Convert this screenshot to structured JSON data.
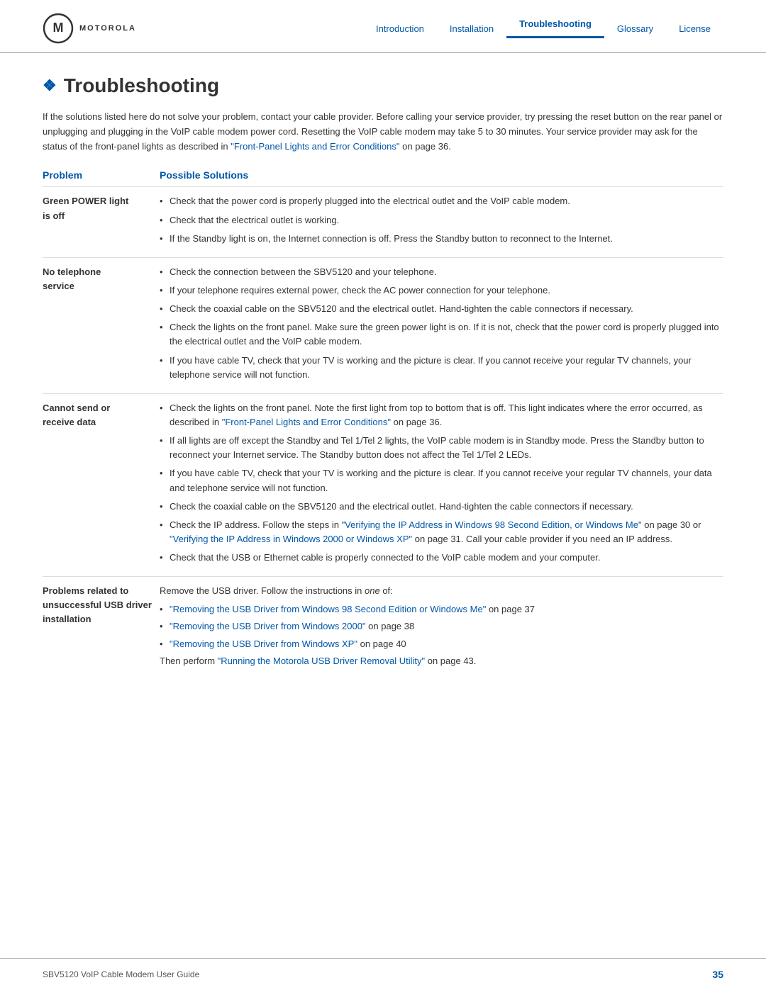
{
  "header": {
    "logo_text": "MOTOROLA",
    "nav": [
      {
        "label": "Introduction",
        "active": false
      },
      {
        "label": "Installation",
        "active": false
      },
      {
        "label": "Troubleshooting",
        "active": true
      },
      {
        "label": "Glossary",
        "active": false
      },
      {
        "label": "License",
        "active": false
      }
    ]
  },
  "page": {
    "title": "Troubleshooting",
    "bullet": "❖",
    "intro": "If the solutions listed here do not solve your problem, contact your cable provider. Before calling your service provider, try pressing the reset button on the rear panel or unplugging and plugging in the VoIP cable modem power cord. Resetting the VoIP cable modem may take 5 to 30 minutes. Your service provider may ask for the status of the front-panel lights as described in",
    "intro_link_text": "\"Front-Panel Lights and Error Conditions\"",
    "intro_end": " on page 36."
  },
  "table": {
    "col1_header": "Problem",
    "col2_header": "Possible Solutions",
    "rows": [
      {
        "problem": "Green POWER light is off",
        "solutions": [
          "Check that the power cord is properly plugged into the electrical outlet and the VoIP cable modem.",
          "Check that the electrical outlet is working.",
          "If the Standby light is on, the Internet connection is off. Press the Standby button to reconnect to the Internet."
        ]
      },
      {
        "problem": "No telephone service",
        "solutions": [
          "Check the connection between the SBV5120 and your telephone.",
          "If your telephone requires external power, check the AC power connection for your telephone.",
          "Check the coaxial cable on the SBV5120 and the electrical outlet. Hand-tighten the cable connectors if necessary.",
          "Check the lights on the front panel. Make sure the green power light is on. If it is not, check that the power cord is properly plugged into the electrical outlet and the VoIP cable modem.",
          "If you have cable TV, check that your TV is working and the picture is clear. If you cannot receive your regular TV channels, your telephone service will not function."
        ]
      },
      {
        "problem": "Cannot send or receive data",
        "solutions": [
          "Check the lights on the front panel. Note the first light from top to bottom that is off. This light indicates where the error occurred, as described in",
          null,
          "If all lights are off except the Standby and Tel 1/Tel 2 lights, the VoIP cable modem is in Standby mode. Press the Standby button to reconnect your Internet service. The Standby button does not affect the Tel 1/Tel 2 LEDs.",
          "If you have cable TV, check that your TV is working and the picture is clear. If you cannot receive your regular TV channels, your data and telephone service will not function.",
          "Check the coaxial cable on the SBV5120 and the electrical outlet. Hand-tighten the cable connectors if necessary.",
          "Check the IP address. Follow the steps in",
          null,
          "Check that the USB or Ethernet cable is properly connected to the VoIP cable modem and your computer."
        ]
      },
      {
        "problem": "Problems related to unsuccessful USB driver installation",
        "solutions": []
      }
    ]
  },
  "footer": {
    "doc_title": "SBV5120 VoIP Cable Modem User Guide",
    "page_number": "35"
  }
}
